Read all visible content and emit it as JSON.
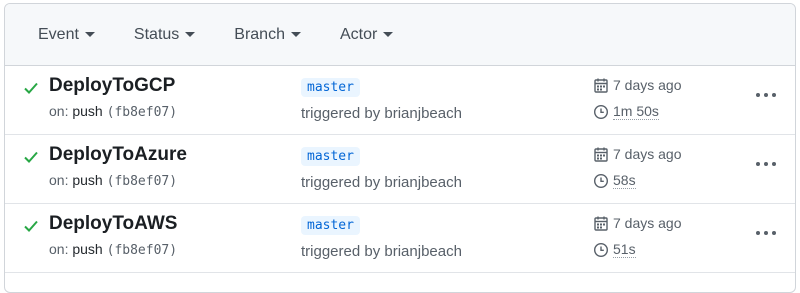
{
  "filters": [
    {
      "label": "Event"
    },
    {
      "label": "Status"
    },
    {
      "label": "Branch"
    },
    {
      "label": "Actor"
    }
  ],
  "runs": [
    {
      "status": "success",
      "name": "DeployToGCP",
      "event_prefix": "on:",
      "event": "push",
      "sha": "fb8ef07",
      "branch": "master",
      "triggered_by": "triggered by brianjbeach",
      "date": "7 days ago",
      "duration": "1m 50s"
    },
    {
      "status": "success",
      "name": "DeployToAzure",
      "event_prefix": "on:",
      "event": "push",
      "sha": "fb8ef07",
      "branch": "master",
      "triggered_by": "triggered by brianjbeach",
      "date": "7 days ago",
      "duration": "58s"
    },
    {
      "status": "success",
      "name": "DeployToAWS",
      "event_prefix": "on:",
      "event": "push",
      "sha": "fb8ef07",
      "branch": "master",
      "triggered_by": "triggered by brianjbeach",
      "date": "7 days ago",
      "duration": "51s"
    }
  ],
  "colors": {
    "success": "#28a745",
    "branch_bg": "#eaf5ff",
    "branch_text": "#0366d6"
  }
}
